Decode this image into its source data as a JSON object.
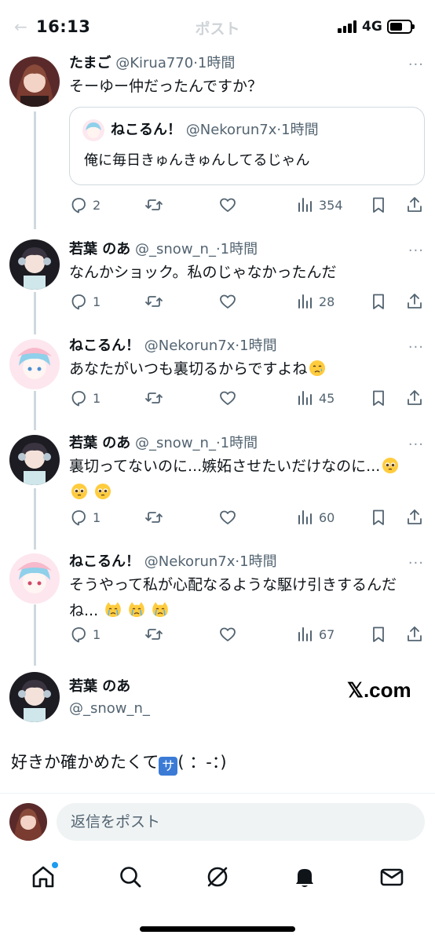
{
  "status_bar": {
    "time": "16:13",
    "network": "4G"
  },
  "header": {
    "title": "ポスト"
  },
  "tweets": [
    {
      "name": "たまご",
      "handle": "@Kirua770",
      "time": "·1時間",
      "text": "そーゆー仲だったんですか？",
      "quote": {
        "name": "ねこるん！",
        "handle": "@Nekorun7x",
        "time": "·1時間",
        "text": "俺に毎日きゅんきゅんしてるじゃん"
      },
      "replies": "2",
      "views": "354"
    },
    {
      "name": "若葉 のあ",
      "handle": "@_snow_n_",
      "time": "·1時間",
      "text": "なんかショック。私のじゃなかったんだ",
      "replies": "1",
      "views": "28"
    },
    {
      "name": "ねこるん！",
      "handle": "@Nekorun7x",
      "time": "·1時間",
      "text": "あなたがいつも裏切るからですよね",
      "replies": "1",
      "views": "45"
    },
    {
      "name": "若葉 のあ",
      "handle": "@_snow_n_",
      "time": "·1時間",
      "text_line1": "裏切ってないのに...嫉妬させたいだけなのに...",
      "replies": "1",
      "views": "60"
    },
    {
      "name": "ねこるん！",
      "handle": "@Nekorun7x",
      "time": "·1時間",
      "text_line1": "そうやって私が心配なるような駆け引きするんだ",
      "text_line2": "ね...",
      "replies": "1",
      "views": "67"
    }
  ],
  "main_tweet": {
    "name": "若葉 のあ",
    "handle": "@_snow_n_",
    "watermark": "𝕏.com",
    "text_before": "好きか確かめたくて",
    "badge": "サ",
    "text_after": "( ：-：)"
  },
  "reply_bar": {
    "placeholder": "返信をポスト"
  },
  "more_label": "···",
  "icons": [
    "reply-icon",
    "retweet-icon",
    "like-icon",
    "views-icon",
    "bookmark-icon",
    "share-icon",
    "home-icon",
    "search-icon",
    "grok-icon",
    "notifications-icon",
    "messages-icon"
  ],
  "colors": {
    "text": "#0f1419",
    "secondary": "#536471",
    "border": "#cfd9de",
    "accent": "#1d9bf0"
  }
}
